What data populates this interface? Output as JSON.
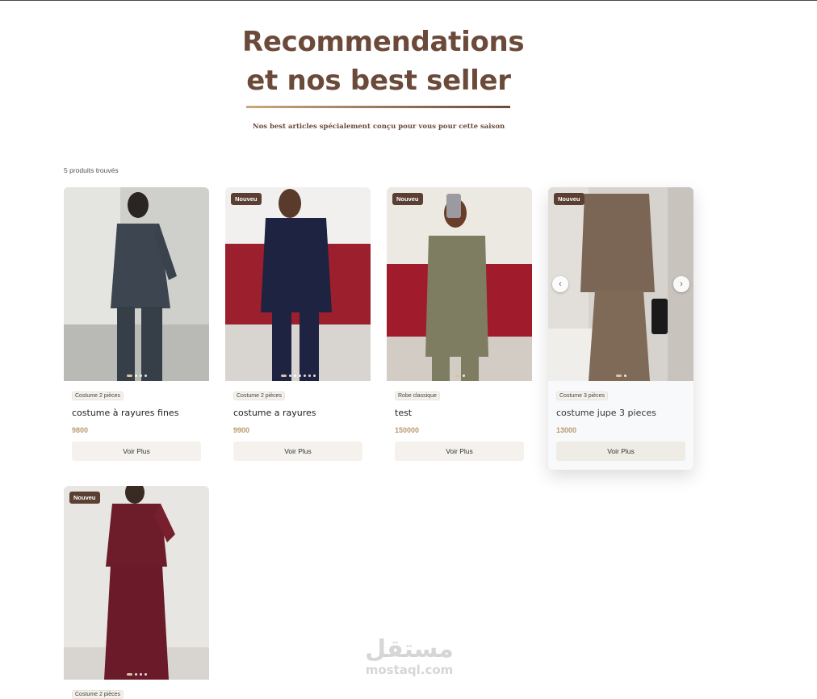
{
  "page": {
    "heading_line1": "Recommendations",
    "heading_line2": "et nos best seller",
    "subtitle": "Nos best articles spécialement conçu pour vous pour cette saison",
    "results_count": "5 produits trouvés"
  },
  "products": [
    {
      "badge": "",
      "category": "Costume 2 pièces",
      "name": "costume à rayures fines",
      "price": "9800",
      "button": "Voir Plus",
      "image_count": 4,
      "active_image": 1
    },
    {
      "badge": "Nouveu",
      "category": "Costume 2 pièces",
      "name": "costume a rayures",
      "price": "9900",
      "button": "Voir Plus",
      "image_count": 7,
      "active_image": 1
    },
    {
      "badge": "Nouveu",
      "category": "Robe classique",
      "name": "test",
      "price": "150000",
      "button": "Voir Plus",
      "image_count": 2,
      "active_image": 1
    },
    {
      "badge": "Nouveu",
      "category": "Costume 3 pièces",
      "name": "costume jupe 3 pieces",
      "price": "13000",
      "button": "Voir Plus",
      "image_count": 2,
      "active_image": 1
    },
    {
      "badge": "Nouveu",
      "category": "Costume 2 pièces",
      "name": "",
      "price": "",
      "button": "",
      "image_count": 4,
      "active_image": 1
    }
  ],
  "carousel": {
    "prev_icon": "chevron-left-icon",
    "next_icon": "chevron-right-icon",
    "prev_glyph": "‹",
    "next_glyph": "›"
  },
  "watermark": {
    "arabic": "مستقل",
    "latin": "mostaql.com"
  },
  "colors": {
    "accent": "#6b4a3a",
    "price": "#b89a72",
    "badge": "#5b3f33"
  }
}
